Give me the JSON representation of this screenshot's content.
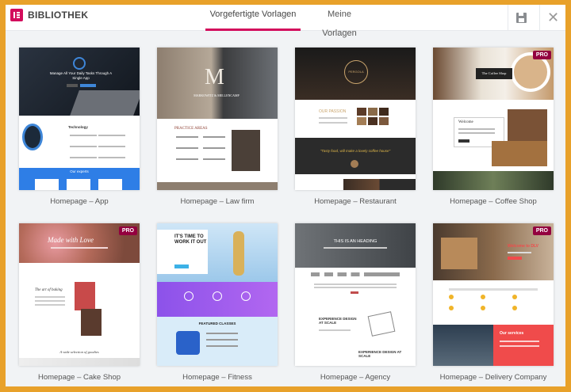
{
  "header": {
    "title": "BIBLIOTHEK",
    "tabs": [
      {
        "label": "Vorgefertigte Vorlagen",
        "active": true
      },
      {
        "label": "Meine Vorlagen",
        "active": false
      }
    ],
    "save_icon": "floppy-disk-icon",
    "close_icon": "close-icon",
    "close_glyph": "✕"
  },
  "colors": {
    "accent": "#d30c5c",
    "pro_badge": "#93003f",
    "frame": "#e8a12a"
  },
  "templates": [
    {
      "label": "Homepage – App",
      "pro": false,
      "preview": {
        "hero": "Manage All Your Daily Tasks Through A Single App",
        "section": "Technology",
        "footer": "Our experts"
      }
    },
    {
      "label": "Homepage – Law firm",
      "pro": false,
      "preview": {
        "hero": "MARKOWITZ & MELLENCAMP",
        "section": "PRACTICE AREAS"
      }
    },
    {
      "label": "Homepage – Restaurant",
      "pro": false,
      "preview": {
        "hero": "PERGOLA",
        "section": "OUR PASSION",
        "quote": "\"Tasty food, will make a lovely coffee house\""
      }
    },
    {
      "label": "Homepage – Coffee Shop",
      "pro": true,
      "preview": {
        "hero": "The Coffee Shop",
        "section": "Welcome"
      }
    },
    {
      "label": "Homepage – Cake Shop",
      "pro": true,
      "preview": {
        "hero": "Made with Love",
        "section": "The art of baking",
        "footer": "A wide selection of goodies"
      }
    },
    {
      "label": "Homepage – Fitness",
      "pro": false,
      "preview": {
        "hero": "IT'S TIME TO WORK IT OUT",
        "section": "FEATURED CLASSES"
      }
    },
    {
      "label": "Homepage – Agency",
      "pro": false,
      "preview": {
        "hero": "THIS IS AN HEADING",
        "section": "EXPERIENCE DESIGN AT SCALE",
        "footer": "EXPERIENCE DESIGN AT SCALE"
      }
    },
    {
      "label": "Homepage – Delivery Company",
      "pro": true,
      "preview": {
        "hero": "Welcome to DLV",
        "section": "Our services"
      }
    }
  ],
  "pro_label": "PRO"
}
